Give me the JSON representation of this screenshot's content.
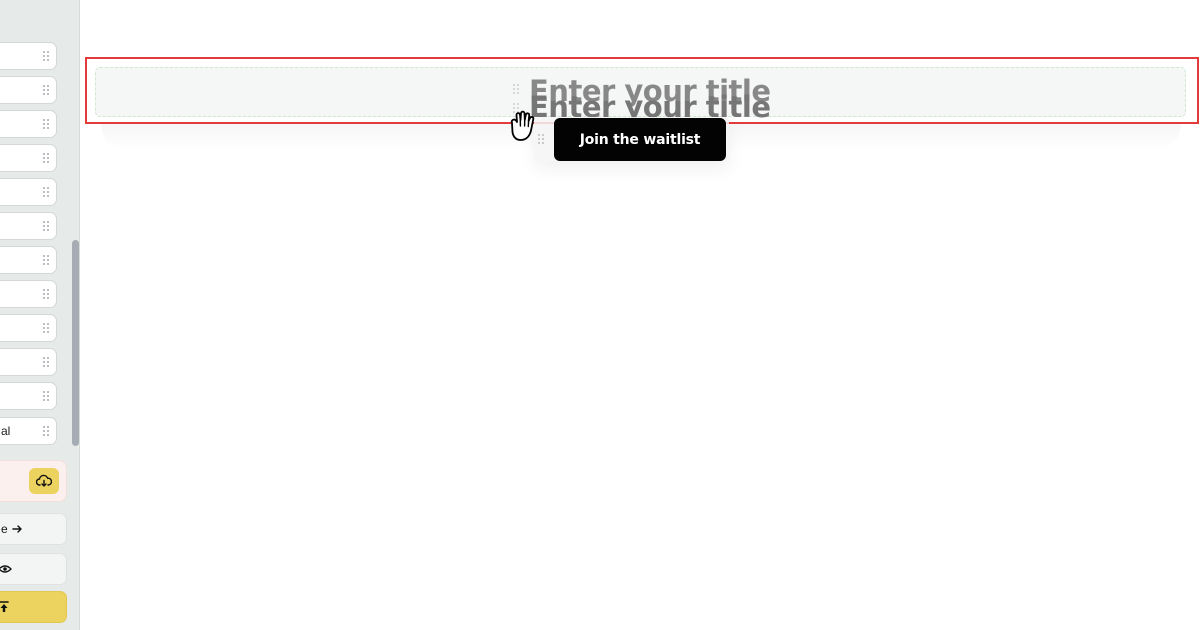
{
  "sidebar": {
    "blocks": [
      {
        "label": ""
      },
      {
        "label": ""
      },
      {
        "label": ""
      },
      {
        "label": ""
      },
      {
        "label": ""
      },
      {
        "label": ""
      },
      {
        "label": ""
      },
      {
        "label": ""
      },
      {
        "label": ""
      },
      {
        "label": ""
      },
      {
        "label": ""
      },
      {
        "label": "al"
      }
    ],
    "buttons": [
      {
        "label": "e",
        "icon": "arrow-right-icon"
      },
      {
        "label": "",
        "icon": "eye-icon"
      },
      {
        "label": "",
        "icon": "upload-icon"
      }
    ],
    "publish_icon": "cloud-download-icon"
  },
  "canvas": {
    "title_placeholder": "Enter your title",
    "title_placeholder_dragged": "Enter your title",
    "cta_label": "Join the waitlist"
  },
  "colors": {
    "selection": "#e23b3b",
    "accent_yellow": "#ecd35f",
    "cta_bg": "#030303"
  }
}
